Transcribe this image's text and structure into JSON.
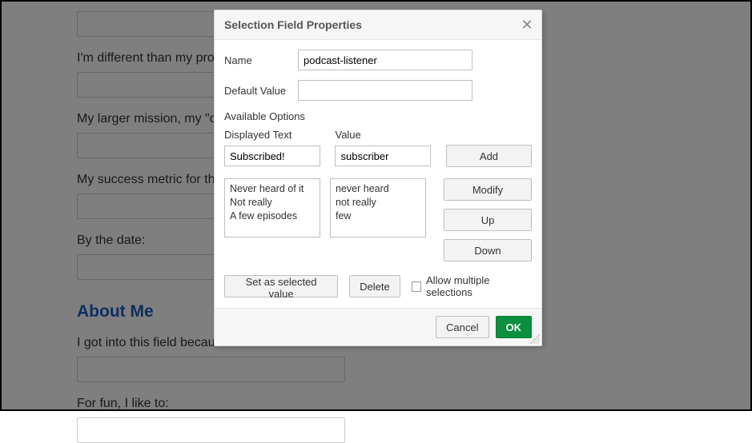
{
  "bg": {
    "fields": [
      {
        "label": ""
      },
      {
        "label": "I'm different than my prosp"
      },
      {
        "label": "My larger mission, my \"der"
      },
      {
        "label": "My success metric for that"
      },
      {
        "label": "By the date:"
      }
    ],
    "section_heading": "About Me",
    "below_fields": [
      {
        "label": "I got into this field because"
      },
      {
        "label": "For fun, I like to:"
      }
    ]
  },
  "dialog": {
    "title": "Selection Field Properties",
    "name_label": "Name",
    "name_value": "podcast-listener",
    "default_label": "Default Value",
    "default_value": "",
    "available_label": "Available Options",
    "displayed_text_label": "Displayed Text",
    "value_label": "Value",
    "displayed_text_input": "Subscribed!",
    "value_input": "subscriber",
    "options_displayed": "Never heard of it\nNot really\nA few episodes",
    "options_values": "never heard\nnot really\nfew",
    "buttons": {
      "add": "Add",
      "modify": "Modify",
      "up": "Up",
      "down": "Down",
      "set_selected": "Set as selected value",
      "delete": "Delete",
      "cancel": "Cancel",
      "ok": "OK"
    },
    "allow_multi_label": "Allow multiple selections"
  }
}
